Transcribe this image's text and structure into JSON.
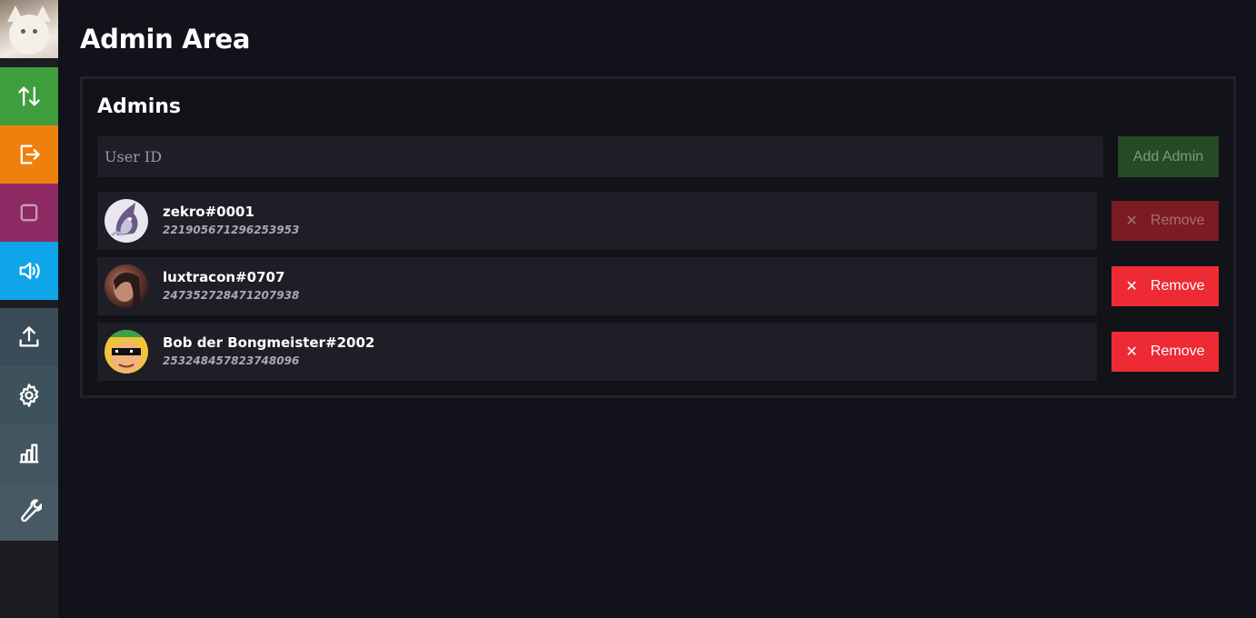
{
  "page": {
    "title": "Admin Area"
  },
  "sidebar": {
    "items": [
      {
        "name": "transfer",
        "icon": "arrows-up-down-icon",
        "color": "#3e9e3e"
      },
      {
        "name": "logout",
        "icon": "logout-icon",
        "color": "#f0800c"
      },
      {
        "name": "stop",
        "icon": "square-icon",
        "color": "#8e2a63"
      },
      {
        "name": "audio",
        "icon": "speaker-icon",
        "color": "#0ea5e9"
      },
      {
        "name": "upload",
        "icon": "upload-icon",
        "color": "#3a4c57"
      },
      {
        "name": "settings",
        "icon": "gear-icon",
        "color": "#3e525c"
      },
      {
        "name": "stats",
        "icon": "bar-chart-icon",
        "color": "#43565f"
      },
      {
        "name": "tools",
        "icon": "wrench-icon",
        "color": "#475a63"
      }
    ]
  },
  "admins": {
    "title": "Admins",
    "input_placeholder": "User ID",
    "add_label": "Add Admin",
    "remove_label": "Remove",
    "remove_icon": "close-icon",
    "list": [
      {
        "name": "zekro#0001",
        "id": "221905671296253953",
        "remove_enabled": false
      },
      {
        "name": "luxtracon#0707",
        "id": "247352728471207938",
        "remove_enabled": true
      },
      {
        "name": "Bob der Bongmeister#2002",
        "id": "253248457823748096",
        "remove_enabled": true
      }
    ]
  },
  "colors": {
    "background": "#12121a",
    "remove_active": "#ee2a35",
    "add_button": "#254a26"
  }
}
